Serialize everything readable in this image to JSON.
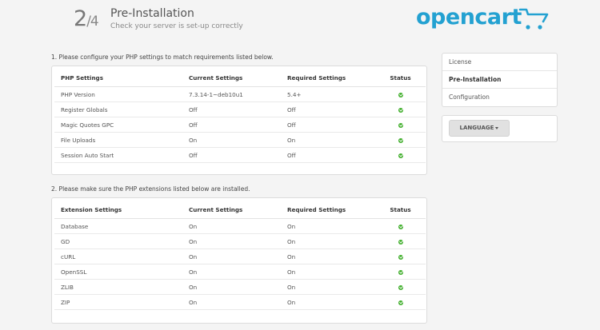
{
  "header": {
    "step_current": "2",
    "step_total": "/4",
    "title": "Pre-Installation",
    "subtitle": "Check your server is set-up correctly"
  },
  "logo": {
    "text": "opencart",
    "color": "#23a1d1"
  },
  "section1": {
    "label": "1. Please configure your PHP settings to match requirements listed below.",
    "headers": [
      "PHP Settings",
      "Current Settings",
      "Required Settings",
      "Status"
    ],
    "rows": [
      {
        "name": "PHP Version",
        "current": "7.3.14-1~deb10u1",
        "required": "5.4+",
        "status": "ok"
      },
      {
        "name": "Register Globals",
        "current": "Off",
        "required": "Off",
        "status": "ok"
      },
      {
        "name": "Magic Quotes GPC",
        "current": "Off",
        "required": "Off",
        "status": "ok"
      },
      {
        "name": "File Uploads",
        "current": "On",
        "required": "On",
        "status": "ok"
      },
      {
        "name": "Session Auto Start",
        "current": "Off",
        "required": "Off",
        "status": "ok"
      }
    ]
  },
  "section2": {
    "label": "2. Please make sure the PHP extensions listed below are installed.",
    "headers": [
      "Extension Settings",
      "Current Settings",
      "Required Settings",
      "Status"
    ],
    "rows": [
      {
        "name": "Database",
        "current": "On",
        "required": "On",
        "status": "ok"
      },
      {
        "name": "GD",
        "current": "On",
        "required": "On",
        "status": "ok"
      },
      {
        "name": "cURL",
        "current": "On",
        "required": "On",
        "status": "ok"
      },
      {
        "name": "OpenSSL",
        "current": "On",
        "required": "On",
        "status": "ok"
      },
      {
        "name": "ZLIB",
        "current": "On",
        "required": "On",
        "status": "ok"
      },
      {
        "name": "ZIP",
        "current": "On",
        "required": "On",
        "status": "ok"
      }
    ]
  },
  "sidebar": {
    "items": [
      {
        "label": "License",
        "active": false
      },
      {
        "label": "Pre-Installation",
        "active": true
      },
      {
        "label": "Configuration",
        "active": false
      }
    ],
    "language_button": "LANGUAGE"
  },
  "colors": {
    "ok": "#3fae2a",
    "brand": "#23a1d1"
  }
}
